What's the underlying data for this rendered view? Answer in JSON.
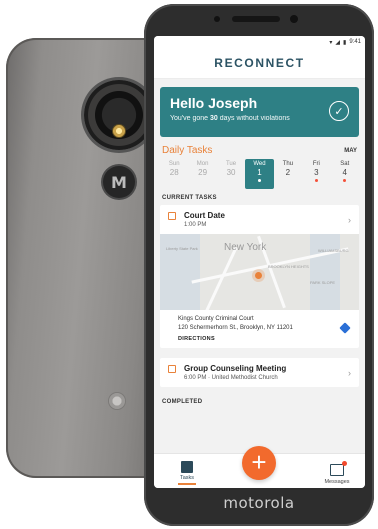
{
  "device": {
    "front_brand": "motorola",
    "back_logo": "M"
  },
  "status_bar": {
    "time": "9:41",
    "icons": [
      "wifi-icon",
      "signal-icon",
      "battery-icon"
    ]
  },
  "app": {
    "logo": "RECONNECT"
  },
  "greeting": {
    "title": "Hello Joseph",
    "sub_prefix": "You've gone ",
    "sub_days": "30",
    "sub_suffix": " days without violations"
  },
  "daily_tasks": {
    "title": "Daily Tasks",
    "month": "MAY",
    "days": [
      {
        "name": "Sun",
        "num": "28",
        "state": "past",
        "dot": false
      },
      {
        "name": "Mon",
        "num": "29",
        "state": "past",
        "dot": false
      },
      {
        "name": "Tue",
        "num": "30",
        "state": "past",
        "dot": false
      },
      {
        "name": "Wed",
        "num": "1",
        "state": "today",
        "dot": true
      },
      {
        "name": "Thu",
        "num": "2",
        "state": "future",
        "dot": false
      },
      {
        "name": "Fri",
        "num": "3",
        "state": "future",
        "dot": true
      },
      {
        "name": "Sat",
        "num": "4",
        "state": "future",
        "dot": true
      }
    ]
  },
  "current_tasks": {
    "label": "CURRENT TASKS",
    "task1": {
      "title": "Court Date",
      "time": "1:00 PM",
      "map_city": "New York",
      "map_labels": [
        "Liberty State Park",
        "WILLIAMSBURG",
        "BROOKLYN HEIGHTS",
        "PARK SLOPE"
      ],
      "address_line1": "Kings County Criminal Court",
      "address_line2": "120 Schermerhorn St., Brooklyn, NY 11201",
      "directions": "DIRECTIONS"
    },
    "task2": {
      "title": "Group Counseling Meeting",
      "detail": "6:00 PM · United Methodist Church"
    }
  },
  "completed": {
    "label": "COMPLETED"
  },
  "nav": {
    "tasks_label": "Tasks",
    "add_label": "+",
    "messages_label": "Messages"
  },
  "colors": {
    "teal": "#2e8085",
    "orange": "#e9823a",
    "fab": "#f26a2d",
    "navy": "#2c4a5a"
  }
}
